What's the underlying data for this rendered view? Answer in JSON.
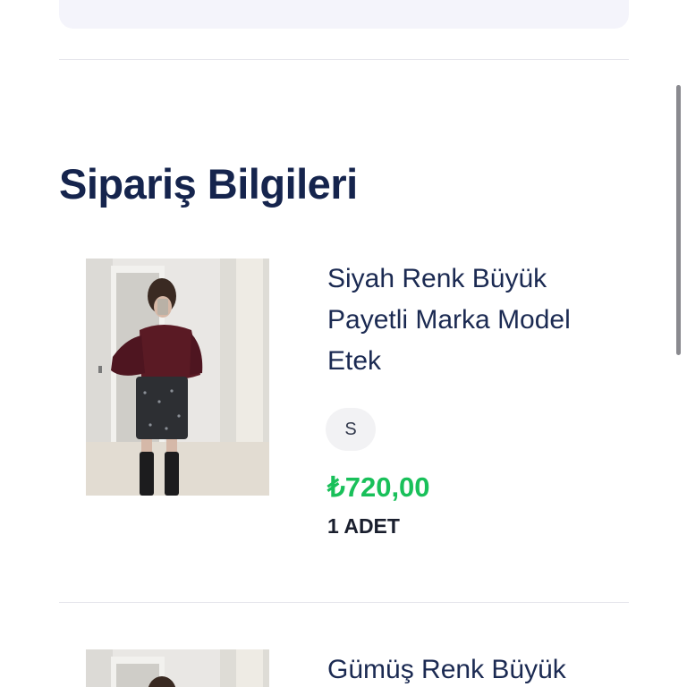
{
  "order_section": {
    "title": "Sipariş Bilgileri"
  },
  "items": [
    {
      "name": "Siyah Renk Büyük Payetli Marka Model Etek",
      "size": "S",
      "price": "₺720,00",
      "quantity": "1 ADET"
    },
    {
      "name": "Gümüş Renk Büyük"
    }
  ],
  "colors": {
    "title": "#15244d",
    "price": "#19c05a",
    "chip_bg": "#f2f2f4",
    "top_card_bg": "#f4f4fb"
  },
  "scroll": {
    "fraction": 0.05
  }
}
